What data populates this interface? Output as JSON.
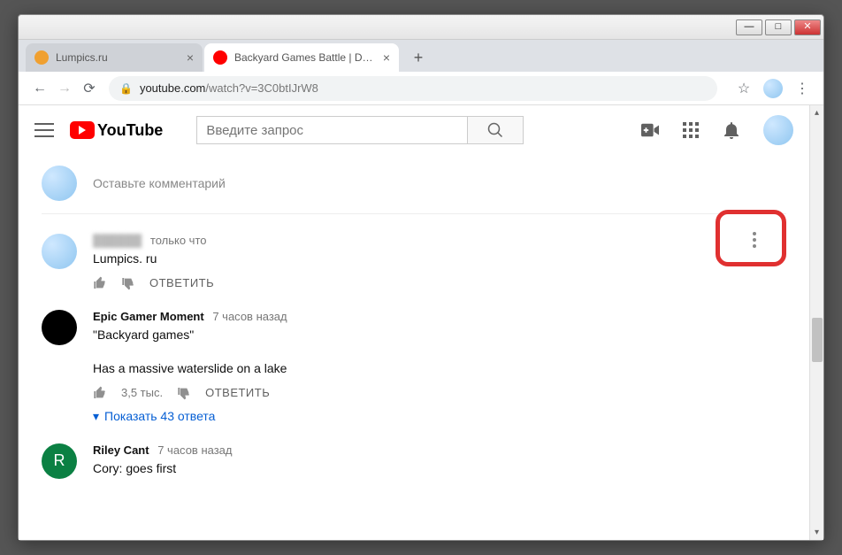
{
  "tabs": [
    {
      "favicon": "#f0a030",
      "title": "Lumpics.ru"
    },
    {
      "favicon": "#ff0000",
      "title": "Backyard Games Battle | Dude Pe"
    }
  ],
  "url": {
    "host": "youtube.com",
    "path": "/watch?v=3C0btIJrW8"
  },
  "youtube": {
    "logo_text": "YouTube",
    "search_placeholder": "Введите запрос",
    "add_comment_placeholder": "Оставьте комментарий"
  },
  "comments": [
    {
      "author": "██████",
      "author_muted": true,
      "time": "только что",
      "text": "Lumpics. ru",
      "likes": "",
      "reply_label": "ОТВЕТИТЬ",
      "show_kebab": true,
      "avatar_type": "gradient"
    },
    {
      "author": "Epic Gamer Moment",
      "time": "7 часов назад",
      "text_line1": "\"Backyard games\"",
      "text_line2": "Has a massive waterslide on a lake",
      "likes": "3,5 тыс.",
      "reply_label": "ОТВЕТИТЬ",
      "view_replies": "Показать 43 ответа",
      "avatar_type": "black"
    },
    {
      "author": "Riley Cant",
      "time": "7 часов назад",
      "text": "Cory: goes first",
      "avatar_type": "green",
      "avatar_letter": "R"
    }
  ]
}
